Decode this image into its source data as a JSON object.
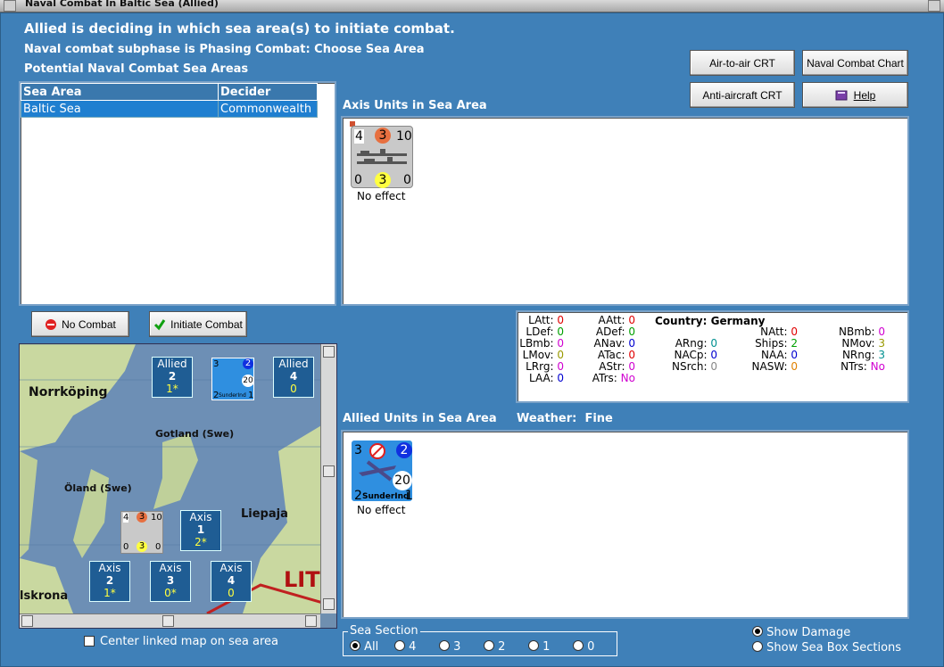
{
  "window": {
    "title": "Naval Combat In Baltic Sea (Allied)"
  },
  "header": {
    "line1": "Allied is deciding in which sea area(s) to initiate combat.",
    "line2": "Naval combat subphase is Phasing Combat: Choose Sea Area",
    "line3": "Potential Naval Combat Sea Areas"
  },
  "buttons": {
    "air_to_air": "Air-to-air CRT",
    "naval_chart": "Naval Combat Chart",
    "anti_aircraft": "Anti-aircraft CRT",
    "help": "Help",
    "no_combat": "No Combat",
    "initiate_combat": "Initiate Combat"
  },
  "sea_area_table": {
    "headers": [
      "Sea Area",
      "Decider"
    ],
    "rows": [
      [
        "Baltic Sea",
        "Commonwealth"
      ]
    ]
  },
  "axis_panel": {
    "label": "Axis Units in Sea Area",
    "unit": {
      "top": [
        "4",
        "3",
        "10"
      ],
      "bottom": [
        "0",
        "3",
        "0"
      ],
      "status": "No effect"
    }
  },
  "allied_panel": {
    "label": "Allied Units in Sea Area",
    "weather_label": "Weather:",
    "weather_value": "Fine",
    "unit": {
      "tl": "3",
      "tr": "2",
      "range": "20",
      "bl": "2",
      "name": "SunderInd",
      "br": "1",
      "status": "No effect"
    }
  },
  "stats": {
    "country_label": "Country:",
    "country": "Germany",
    "col1": [
      [
        "LAtt:",
        "0",
        "red"
      ],
      [
        "LDef:",
        "0",
        "green"
      ],
      [
        "LBmb:",
        "0",
        "mag"
      ],
      [
        "LMov:",
        "0",
        "olive"
      ],
      [
        "LRrg:",
        "0",
        "mag"
      ],
      [
        "LAA:",
        "0",
        "blue"
      ]
    ],
    "col2": [
      [
        "AAtt:",
        "0",
        "red"
      ],
      [
        "ADef:",
        "0",
        "green"
      ],
      [
        "ANav:",
        "0",
        "blue"
      ],
      [
        "ATac:",
        "0",
        "red"
      ],
      [
        "AStr:",
        "0",
        "mag"
      ],
      [
        "ATrs:",
        "No",
        "mag"
      ]
    ],
    "col3": [
      [
        "ARng:",
        "0",
        "teal"
      ],
      [
        "NACp:",
        "0",
        "blue"
      ],
      [
        "NSrch:",
        "0",
        "gray"
      ]
    ],
    "col4": [
      [
        "NAtt:",
        "0",
        "red"
      ],
      [
        "Ships:",
        "2",
        "green"
      ],
      [
        "NAA:",
        "0",
        "blue"
      ],
      [
        "NASW:",
        "0",
        "orange"
      ]
    ],
    "col5": [
      [
        "NBmb:",
        "0",
        "mag"
      ],
      [
        "NMov:",
        "3",
        "olive"
      ],
      [
        "NRng:",
        "3",
        "teal"
      ],
      [
        "NTrs:",
        "No",
        "mag"
      ]
    ]
  },
  "map": {
    "places": [
      "Norrköping",
      "Gotland (Swe)",
      "Öland (Swe)",
      "Liepaja",
      "lskrona",
      "LIT"
    ],
    "boxes": [
      {
        "side": "Allied",
        "num": "2",
        "sub": "1*"
      },
      {
        "side": "Allied",
        "num": "4",
        "sub": "0"
      },
      {
        "side": "Axis",
        "num": "1",
        "sub": "2*"
      },
      {
        "side": "Axis",
        "num": "2",
        "sub": "1*"
      },
      {
        "side": "Axis",
        "num": "3",
        "sub": "0*"
      },
      {
        "side": "Axis",
        "num": "4",
        "sub": "0"
      }
    ],
    "mini_axis": [
      "4",
      "3",
      "10",
      "0",
      "3",
      "0"
    ],
    "mini_allied": [
      "3",
      "2",
      "20",
      "2",
      "SunderInd",
      "1"
    ]
  },
  "center_linked": "Center linked map on sea area",
  "sea_section": {
    "legend": "Sea Section",
    "options": [
      "All",
      "4",
      "3",
      "2",
      "1",
      "0"
    ],
    "selected": "All"
  },
  "display_options": {
    "show_damage": "Show Damage",
    "show_sea_box": "Show Sea Box Sections",
    "selected": "show_damage"
  }
}
